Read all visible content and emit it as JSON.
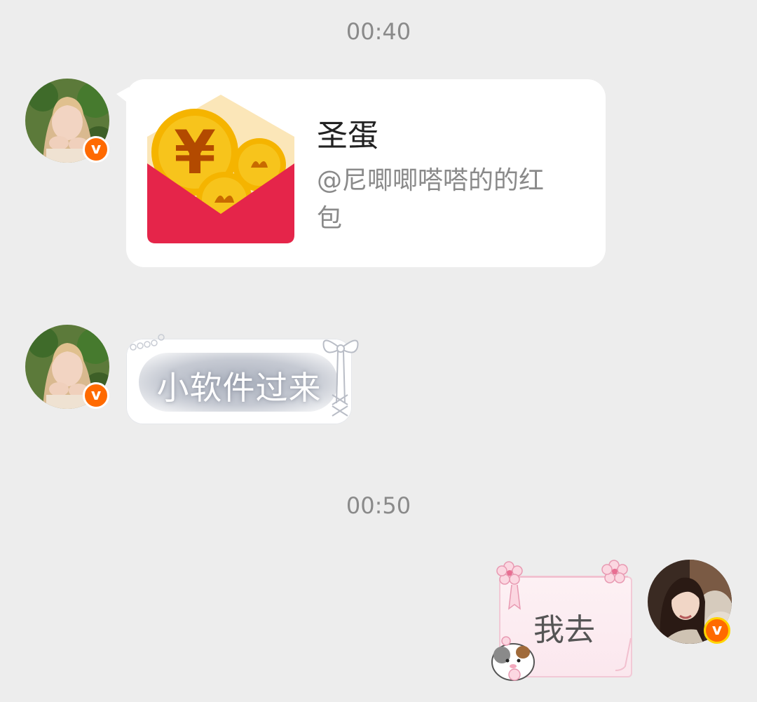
{
  "chat": {
    "timestamps": [
      "00:40",
      "00:50"
    ],
    "messages": [
      {
        "sender": "other",
        "type": "red_packet",
        "title": "圣蛋",
        "subtitle_line1": "@尼唧唧嗒嗒的的红",
        "subtitle_line2": "包",
        "icon": "red-packet-icon"
      },
      {
        "sender": "other",
        "type": "text",
        "text": "小软件过来"
      },
      {
        "sender": "self",
        "type": "text",
        "text": "我去"
      }
    ],
    "badge": {
      "label": "v",
      "color": "#ff6a00"
    },
    "colors": {
      "background": "#ededed",
      "red_packet_red": "#e5254a",
      "coin_gold": "#f5b400"
    }
  }
}
